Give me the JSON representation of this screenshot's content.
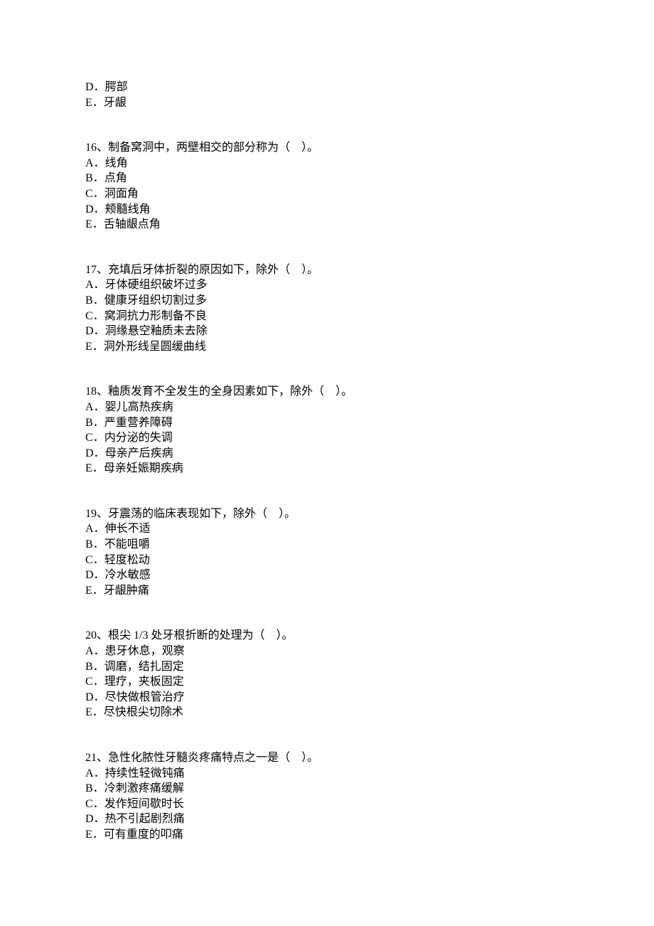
{
  "orphan_options": [
    {
      "label": "D．",
      "text": "腭部"
    },
    {
      "label": "E．",
      "text": "牙龈"
    }
  ],
  "questions": [
    {
      "number": "16、",
      "stem": "制备窝洞中，两壁相交的部分称为（　）。",
      "options": [
        {
          "label": "A．",
          "text": "线角"
        },
        {
          "label": "B．",
          "text": "点角"
        },
        {
          "label": "C．",
          "text": "洞面角"
        },
        {
          "label": "D．",
          "text": "颊髓线角"
        },
        {
          "label": "E．",
          "text": "舌轴龈点角"
        }
      ]
    },
    {
      "number": "17、",
      "stem": "充填后牙体折裂的原因如下，除外（　）。",
      "options": [
        {
          "label": "A．",
          "text": "牙体硬组织破坏过多"
        },
        {
          "label": "B．",
          "text": "健康牙组织切割过多"
        },
        {
          "label": "C．",
          "text": "窝洞抗力形制备不良"
        },
        {
          "label": "D．",
          "text": "洞缘悬空釉质未去除"
        },
        {
          "label": "E．",
          "text": "洞外形线呈圆缓曲线"
        }
      ]
    },
    {
      "number": "18、",
      "stem": "釉质发育不全发生的全身因素如下，除外（　）。",
      "options": [
        {
          "label": "A．",
          "text": "婴儿高热疾病"
        },
        {
          "label": "B．",
          "text": "严重营养障碍"
        },
        {
          "label": "C．",
          "text": "内分泌的失调"
        },
        {
          "label": "D．",
          "text": "母亲产后疾病"
        },
        {
          "label": "E．",
          "text": "母亲妊娠期疾病"
        }
      ]
    },
    {
      "number": "19、",
      "stem": "牙震荡的临床表现如下，除外（　）。",
      "options": [
        {
          "label": "A．",
          "text": "伸长不适"
        },
        {
          "label": "B．",
          "text": "不能咀嚼"
        },
        {
          "label": "C．",
          "text": "轻度松动"
        },
        {
          "label": "D．",
          "text": "冷水敏感"
        },
        {
          "label": "E．",
          "text": "牙龈肿痛"
        }
      ]
    },
    {
      "number": "20、",
      "stem": "根尖 1/3 处牙根折断的处理为（　）。",
      "options": [
        {
          "label": "A．",
          "text": "患牙休息，观察"
        },
        {
          "label": "B．",
          "text": "调磨，结扎固定"
        },
        {
          "label": "C．",
          "text": "理疗，夹板固定"
        },
        {
          "label": "D．",
          "text": "尽快做根管治疗"
        },
        {
          "label": "E．",
          "text": "尽快根尖切除术"
        }
      ]
    },
    {
      "number": "21、",
      "stem": "急性化脓性牙髓炎疼痛特点之一是（　）。",
      "options": [
        {
          "label": "A．",
          "text": "持续性轻微钝痛"
        },
        {
          "label": "B．",
          "text": "冷刺激疼痛缓解"
        },
        {
          "label": "C．",
          "text": "发作短间歇时长"
        },
        {
          "label": "D．",
          "text": "热不引起剧烈痛"
        },
        {
          "label": "E．",
          "text": "可有重度的叩痛"
        }
      ]
    }
  ]
}
